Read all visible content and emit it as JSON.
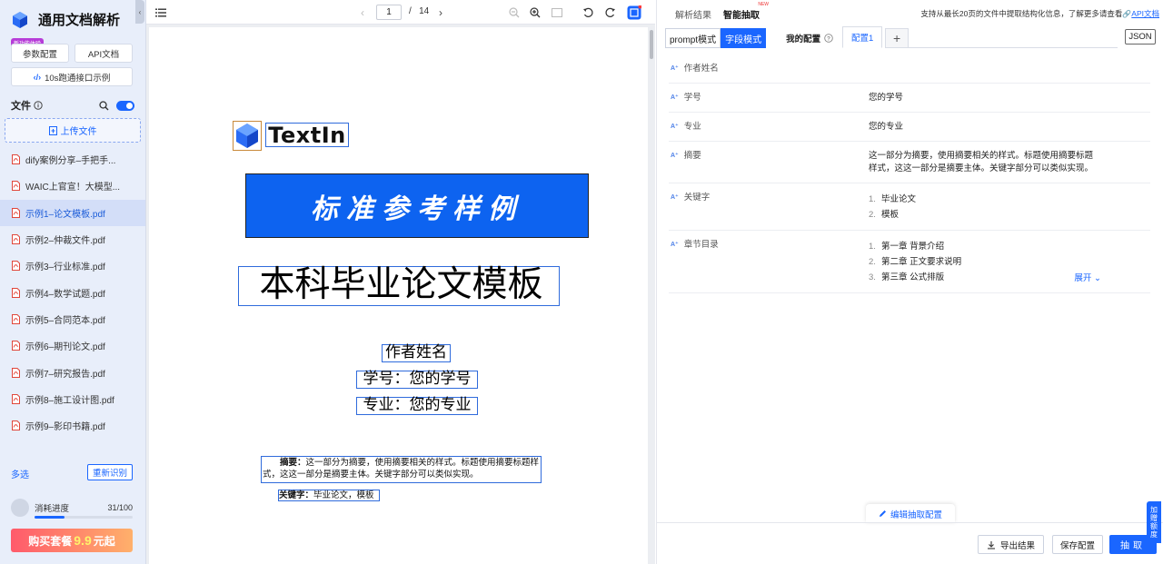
{
  "sidebar": {
    "app_title": "通用文档解析",
    "new_badge": "新功能体验",
    "param_button": "参数配置",
    "api_doc_button": "API文档",
    "quick_start_button": "10s跑通接口示例",
    "files_label": "文件",
    "upload_label": "上传文件",
    "files": [
      {
        "name": "dify案例分享–手把手..."
      },
      {
        "name": "WAIC上官宣！大模型..."
      },
      {
        "name": "示例1–论文模板.pdf"
      },
      {
        "name": "示例2–仲裁文件.pdf"
      },
      {
        "name": "示例3–行业标准.pdf"
      },
      {
        "name": "示例4–数学试题.pdf"
      },
      {
        "name": "示例5–合同范本.pdf"
      },
      {
        "name": "示例6–期刊论文.pdf"
      },
      {
        "name": "示例7–研究报告.pdf"
      },
      {
        "name": "示例8–施工设计图.pdf"
      },
      {
        "name": "示例9–影印书籍.pdf"
      }
    ],
    "active_file_index": 2,
    "multi_select": "多选",
    "re_recognize": "重新识别",
    "usage_label": "消耗进度",
    "usage_count": "31/100",
    "usage_fraction": 0.31,
    "buy_prefix": "购买套餐",
    "buy_price": "9.9",
    "buy_suffix": "元起"
  },
  "viewer": {
    "page_current": "1",
    "page_sep": "/",
    "page_total": "14",
    "logo_text": "TextIn",
    "banner": "标准参考样例",
    "title": "本科毕业论文模板",
    "author": "作者姓名",
    "student_id": "学号：您的学号",
    "major": "专业：您的专业",
    "abstract_label": "摘要：",
    "abstract_text": "这一部分为摘要，使用摘要相关的样式。标题使用摘要标题样式，这这一部分是摘要主体。关键字部分可以类似实现。",
    "keywords_label": "关键字：",
    "keywords_text": "毕业论文，模板"
  },
  "right": {
    "tab_parse": "解析结果",
    "tab_extract": "智能抽取",
    "tab_new": "NEW",
    "info_text": "支持从最长20页的文件中提取结构化信息，了解更多请查看",
    "info_link": "API文档",
    "mode_prompt": "prompt模式",
    "mode_field": "字段模式",
    "my_config": "我的配置",
    "config_tab": "配置1",
    "add_tab": "+",
    "json_btn": "JSON",
    "fields": [
      {
        "key": "作者姓名",
        "value": ""
      },
      {
        "key": "学号",
        "value": "您的学号"
      },
      {
        "key": "专业",
        "value": "您的专业"
      },
      {
        "key": "摘要",
        "value": "这一部分为摘要，使用摘要相关的样式。标题使用摘要标题样式，这这一部分是摘要主体。关键字部分可以类似实现。"
      }
    ],
    "keywords_field": {
      "key": "关键字",
      "items": [
        "毕业论文",
        "模板"
      ]
    },
    "chapters_field": {
      "key": "章节目录",
      "items": [
        "第一章 背景介绍",
        "第二章 正文要求说明",
        "第三章 公式排版"
      ],
      "expand": "展开"
    },
    "edit_config": "编辑抽取配置",
    "export_btn": "导出结果",
    "save_btn": "保存配置",
    "extract_btn": "抽取",
    "float_tab": "加赠额度"
  },
  "colors": {
    "accent": "#1a66ff",
    "sidebar_bg": "#e8eefa",
    "banner": "#0d63f0"
  }
}
